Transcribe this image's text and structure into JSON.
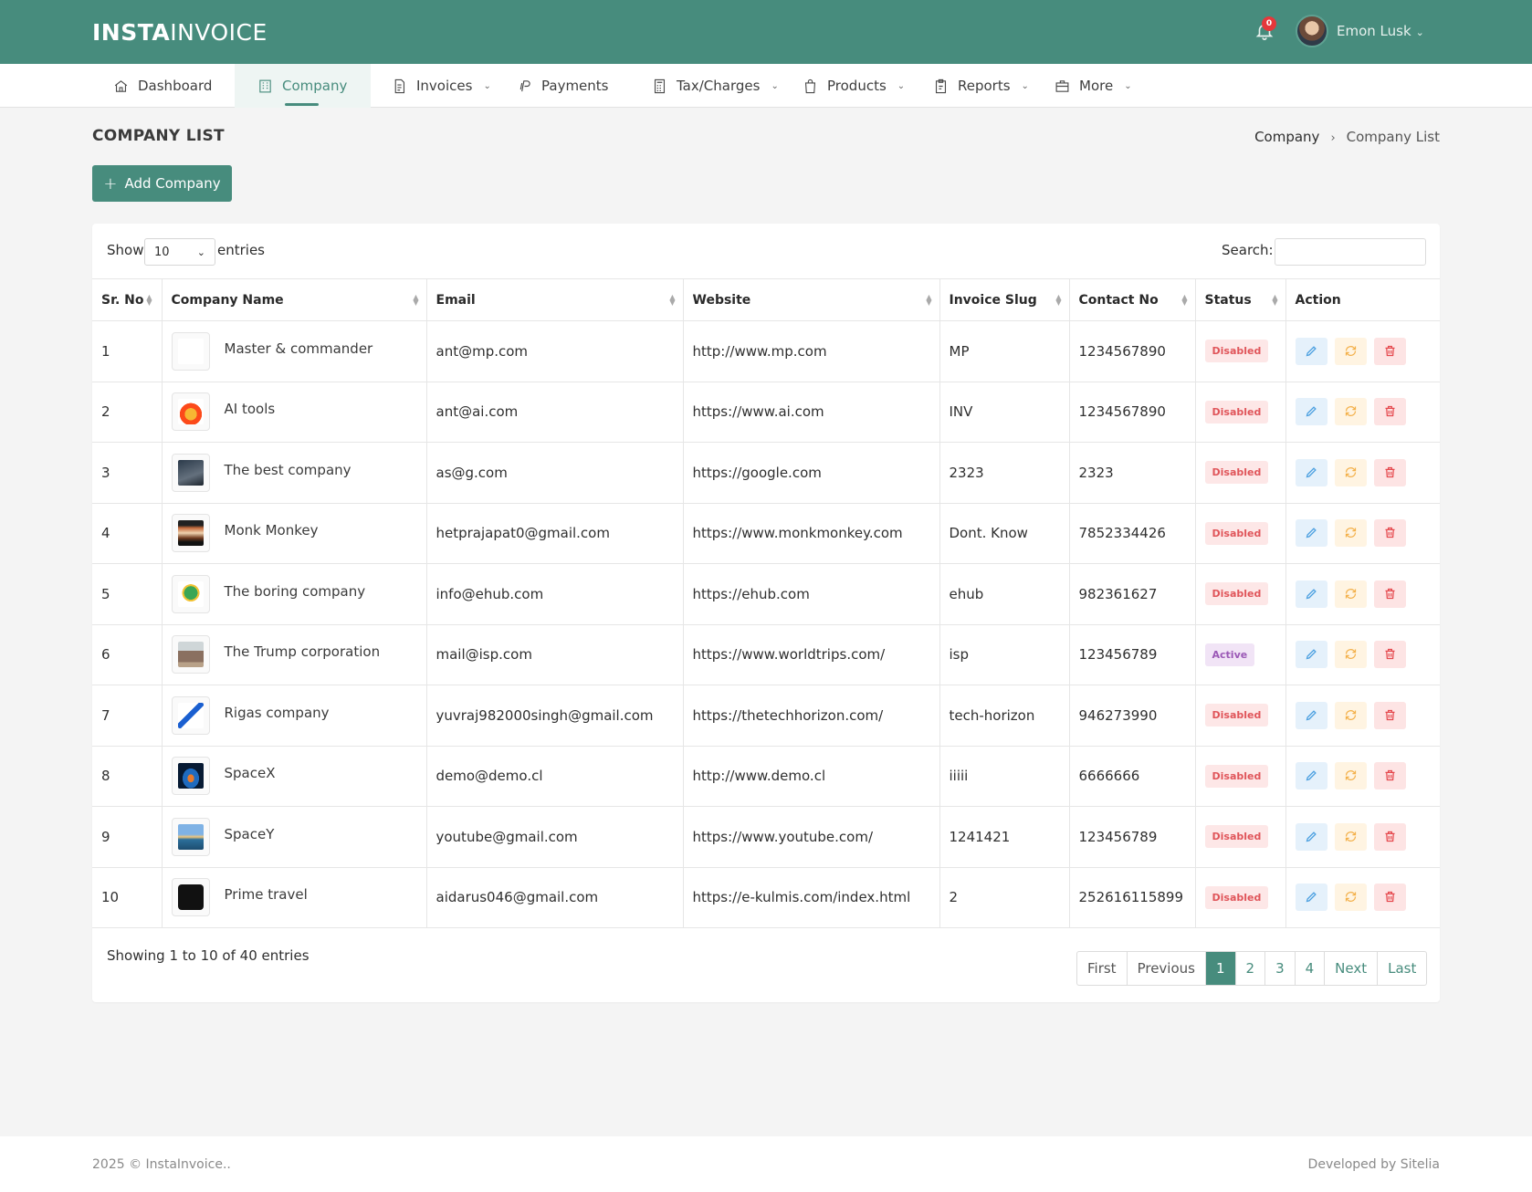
{
  "header": {
    "brand_bold": "INSTA",
    "brand_light": "INVOICE",
    "notification_count": "0",
    "user_name": "Emon Lusk"
  },
  "nav": [
    {
      "label": "Dashboard",
      "icon": "home-icon"
    },
    {
      "label": "Company",
      "icon": "building-icon"
    },
    {
      "label": "Invoices",
      "icon": "file-icon"
    },
    {
      "label": "Payments",
      "icon": "paypal-icon"
    },
    {
      "label": "Tax/Charges",
      "icon": "calculator-icon"
    },
    {
      "label": "Products",
      "icon": "bag-icon"
    },
    {
      "label": "Reports",
      "icon": "clipboard-icon"
    },
    {
      "label": "More",
      "icon": "briefcase-icon"
    }
  ],
  "page": {
    "title": "COMPANY LIST",
    "breadcrumb": [
      "Company",
      "Company List"
    ],
    "add_button": "Add Company"
  },
  "table_controls": {
    "show_label": "Show",
    "entries_value": "10",
    "entries_label": "entries",
    "search_label": "Search:"
  },
  "columns": [
    "Sr. No",
    "Company Name",
    "Email",
    "Website",
    "Invoice Slug",
    "Contact No",
    "Status",
    "Action"
  ],
  "rows": [
    {
      "sr": "1",
      "name": "Master & commander",
      "email": "ant@mp.com",
      "website": "http://www.mp.com",
      "slug": "MP",
      "contact": "1234567890",
      "status": "Disabled"
    },
    {
      "sr": "2",
      "name": "AI tools",
      "email": "ant@ai.com",
      "website": "https://www.ai.com",
      "slug": "INV",
      "contact": "1234567890",
      "status": "Disabled"
    },
    {
      "sr": "3",
      "name": "The best company",
      "email": "as@g.com",
      "website": "https://google.com",
      "slug": "2323",
      "contact": "2323",
      "status": "Disabled"
    },
    {
      "sr": "4",
      "name": "Monk Monkey",
      "email": "hetprajapat0@gmail.com",
      "website": "https://www.monkmonkey.com",
      "slug": "Dont. Know",
      "contact": "7852334426",
      "status": "Disabled"
    },
    {
      "sr": "5",
      "name": "The boring company",
      "email": "info@ehub.com",
      "website": "https://ehub.com",
      "slug": "ehub",
      "contact": "982361627",
      "status": "Disabled"
    },
    {
      "sr": "6",
      "name": "The Trump corporation",
      "email": "mail@isp.com",
      "website": "https://www.worldtrips.com/",
      "slug": "isp",
      "contact": "123456789",
      "status": "Active"
    },
    {
      "sr": "7",
      "name": "Rigas company",
      "email": "yuvraj982000singh@gmail.com",
      "website": "https://thetechhorizon.com/",
      "slug": "tech-horizon",
      "contact": "946273990",
      "status": "Disabled"
    },
    {
      "sr": "8",
      "name": "SpaceX",
      "email": "demo@demo.cl",
      "website": "http://www.demo.cl",
      "slug": "iiiii",
      "contact": "6666666",
      "status": "Disabled"
    },
    {
      "sr": "9",
      "name": "SpaceY",
      "email": "youtube@gmail.com",
      "website": "https://www.youtube.com/",
      "slug": "1241421",
      "contact": "123456789",
      "status": "Disabled"
    },
    {
      "sr": "10",
      "name": "Prime travel",
      "email": "aidarus046@gmail.com",
      "website": "https://e-kulmis.com/index.html",
      "slug": "2",
      "contact": "252616115899",
      "status": "Disabled"
    }
  ],
  "pagination": {
    "info": "Showing 1 to 10 of 40 entries",
    "first": "First",
    "previous": "Previous",
    "pages": [
      "1",
      "2",
      "3",
      "4"
    ],
    "next": "Next",
    "last": "Last"
  },
  "footer": {
    "left": "2025 © InstaInvoice..",
    "right": "Developed by Sitelia"
  },
  "colors": {
    "brand": "#478c7d",
    "disabled_badge": "#e0555a",
    "active_badge": "#9b59b6"
  }
}
